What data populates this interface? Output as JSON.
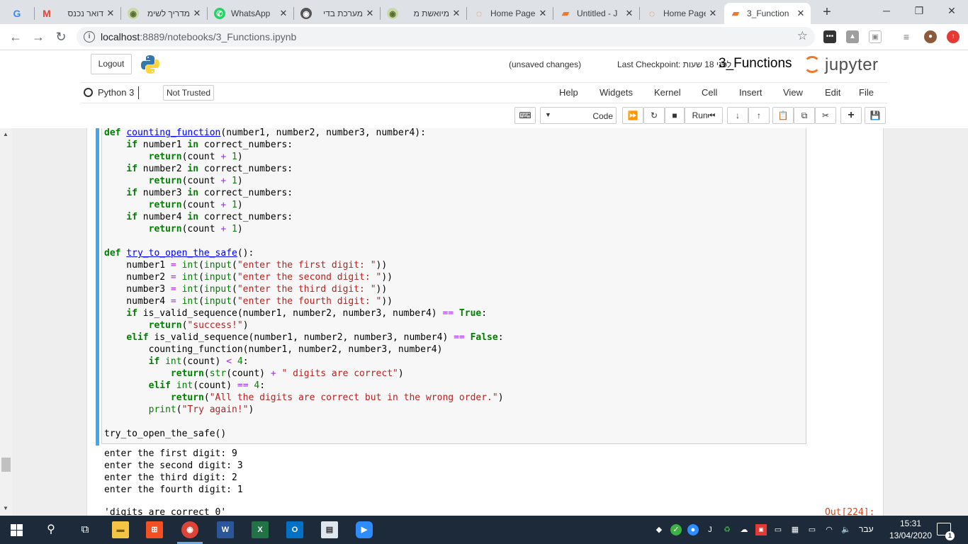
{
  "browser": {
    "tabs": [
      {
        "title": "",
        "favicon": "google-g",
        "color": "#ea4335"
      },
      {
        "title": "דואר נכנס",
        "favicon": "gmail-m",
        "color": "#ea4335"
      },
      {
        "title": "מדריך לשימ",
        "favicon": "globe",
        "color": "#6b8e23"
      },
      {
        "title": "WhatsApp",
        "favicon": "whatsapp",
        "color": "#25d366"
      },
      {
        "title": "מערכת בדי",
        "favicon": "globe",
        "color": "#555555"
      },
      {
        "title": "מיואשת מ",
        "favicon": "globe",
        "color": "#6b8e23"
      },
      {
        "title": "Home Page",
        "favicon": "jupyter",
        "color": "#f37726"
      },
      {
        "title": "Untitled - J",
        "favicon": "notebook",
        "color": "#f37726"
      },
      {
        "title": "Home Page",
        "favicon": "jupyter",
        "color": "#f37726"
      },
      {
        "title": "3_Function",
        "favicon": "notebook",
        "color": "#f37726"
      }
    ],
    "new_tab_symbol": "+",
    "url_host": "localhost",
    "url_path": ":8889/notebooks/3_Functions.ipynb"
  },
  "jupyter": {
    "logout_label": "Logout",
    "logo_word": "jupyter",
    "notebook_name": "3_Functions",
    "checkpoint_text": "Last Checkpoint: לפני 18 שעות",
    "unsaved_text": "(unsaved changes)",
    "kernel_name": "Python 3",
    "trust_label": "Not Trusted",
    "menu": [
      "File",
      "Edit",
      "View",
      "Insert",
      "Cell",
      "Kernel",
      "Widgets",
      "Help"
    ],
    "toolbar": {
      "run_label": "Run",
      "cell_type": "Code"
    }
  },
  "cell": {
    "code_lines": [
      "def counting_function(number1, number2, number3, number4):",
      "    if number1 in correct_numbers:",
      "        return(count + 1)",
      "    if number2 in correct_numbers:",
      "        return(count + 1)",
      "    if number3 in correct_numbers:",
      "        return(count + 1)",
      "    if number4 in correct_numbers:",
      "        return(count + 1)",
      "",
      "def try_to_open_the_safe():",
      "    number1 = int(input(\"enter the first digit: \"))",
      "    number2 = int(input(\"enter the second digit: \"))",
      "    number3 = int(input(\"enter the third digit: \"))",
      "    number4 = int(input(\"enter the fourth digit: \"))",
      "    if is_valid_sequence(number1, number2, number3, number4) == True:",
      "        return(\"success!\")",
      "    elif is_valid_sequence(number1, number2, number3, number4) == False:",
      "        counting_function(number1, number2, number3, number4)",
      "        if int(count) < 4:",
      "            return(str(count) + \" digits are correct\")",
      "        elif int(count) == 4:",
      "            return(\"All the digits are correct but in the wrong order.\")",
      "        print(\"Try again!\")",
      "",
      "try_to_open_the_safe()"
    ],
    "stdout_lines": [
      "enter the first digit: 9",
      "enter the second digit: 3",
      "enter the third digit: 2",
      "enter the fourth digit: 1"
    ],
    "result": "'digits are correct 0'",
    "out_prompt": "Out[224]:"
  },
  "taskbar": {
    "time": "15:31",
    "date": "13/04/2020",
    "language": "עבר",
    "notification_count": "1"
  }
}
